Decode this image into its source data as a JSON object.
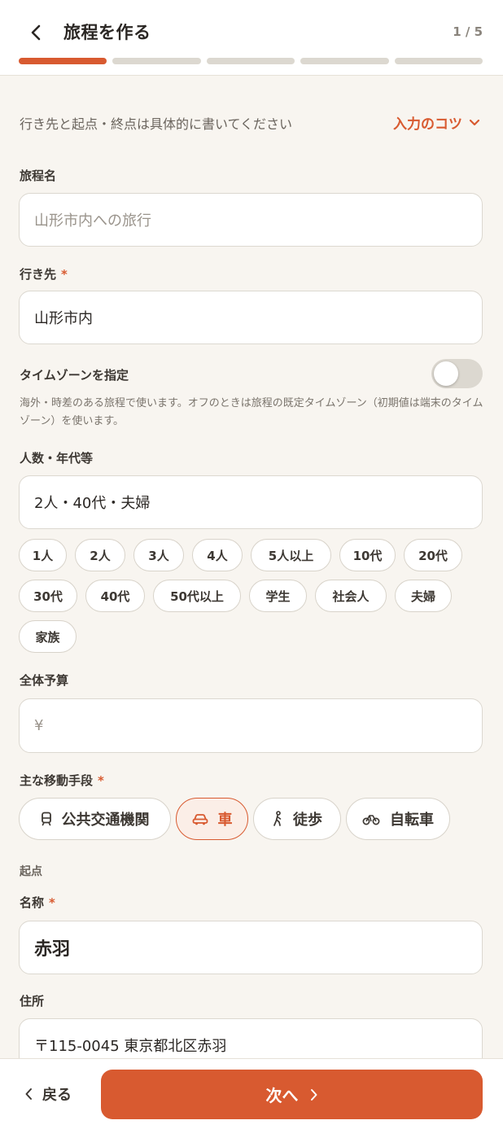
{
  "header": {
    "title": "旅程を作る",
    "step_counter": "1 / 5",
    "progress_total_steps": 5,
    "progress_current_step": 1
  },
  "form": {
    "hint_text": "行き先と起点・終点は具体的に書いてください",
    "tips_label": "入力のコツ",
    "trip_name": {
      "label": "旅程名",
      "placeholder": "山形市内への旅行"
    },
    "destination": {
      "label": "行き先",
      "required_mark": "*",
      "value": "山形市内"
    },
    "timezone": {
      "label": "タイムゾーンを指定",
      "enabled": false,
      "description": "海外・時差のある旅程で使います。オフのときは旅程の既定タイムゾーン（初期値は端末のタイムゾーン）を使います。"
    },
    "people": {
      "label": "人数・年代等",
      "value": "2人・40代・夫婦",
      "chips_row1": [
        "1人",
        "2人",
        "3人",
        "4人",
        "5人以上",
        "10代",
        "20代"
      ],
      "chips_row2": [
        "30代",
        "40代",
        "50代以上",
        "学生",
        "社会人",
        "夫婦"
      ],
      "chips_row3": [
        "家族"
      ]
    },
    "budget": {
      "label": "全体予算",
      "prefix": "¥",
      "value": ""
    },
    "transport": {
      "label": "主な移動手段",
      "required_mark": "*",
      "options": [
        {
          "label": "公共交通機関",
          "icon": "train-icon",
          "selected": false
        },
        {
          "label": "車",
          "icon": "car-icon",
          "selected": true
        },
        {
          "label": "徒歩",
          "icon": "walking-icon",
          "selected": false
        },
        {
          "label": "自転車",
          "icon": "bicycle-icon",
          "selected": false
        }
      ]
    },
    "origin": {
      "section_label": "起点",
      "name_label": "名称",
      "required_mark": "*",
      "name_value": "赤羽",
      "address_label": "住所",
      "address_value": "〒115-0045 東京都北区赤羽"
    }
  },
  "footer": {
    "back_label": "戻る",
    "next_label": "次へ"
  },
  "colors": {
    "accent": "#d85a30",
    "background": "#f8f5f0",
    "border": "#dcd8d0"
  }
}
